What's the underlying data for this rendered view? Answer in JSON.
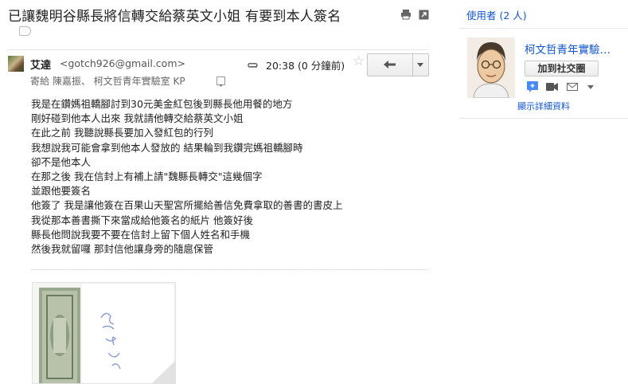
{
  "subject": "已讓魏明谷縣長將信轉交給蔡英文小姐 有要到本人簽名",
  "message": {
    "sender_name": "艾達",
    "sender_email": "<gotch926@gmail.com>",
    "time": "20:38 (0 分鐘前)",
    "recipients": "寄給 陳嘉振、 柯文哲青年實驗室 KP",
    "body_lines": [
      "我是在鑽媽祖轎腳討到30元美金紅包後到縣長他用餐的地方",
      "剛好碰到他本人出來 我就請他轉交給蔡英文小姐",
      "在此之前 我聽說縣長要加入發紅包的行列",
      "我想說我可能會拿到他本人發放的 結果輪到我鑽完媽祖轎腳時",
      "卻不是他本人",
      "在那之後 我在信封上有補上請\"魏縣長轉交\"這幾個字",
      "並跟他要簽名",
      "他簽了 我是讓他簽在百果山天聖宮所擺給善信免費拿取的善書的書皮上",
      "我從那本善書撕下來當成給他簽名的紙片 他簽好後",
      "縣長他問說我要不要在信封上留下個人姓名和手機",
      "然後我就留囉 那封信他讓身旁的隨扈保管"
    ]
  },
  "icons": {
    "print": "print-icon",
    "new_window": "new-window-icon",
    "attachment": "paperclip-icon",
    "star": "star-icon",
    "reply": "reply-icon",
    "more": "dropdown-arrow-icon",
    "label": "label-icon",
    "chat": "chat-icon",
    "video": "video-icon",
    "mail": "mail-icon"
  },
  "sidebar": {
    "people_title": "使用者 (2 人)",
    "contact_name": "柯文哲青年實驗…",
    "add_to_circles": "加到社交圈",
    "show_details": "顯示詳細資料"
  },
  "colors": {
    "link": "#1155cc",
    "divider": "#e5e5e5",
    "chat_blue": "#4a8af4"
  }
}
